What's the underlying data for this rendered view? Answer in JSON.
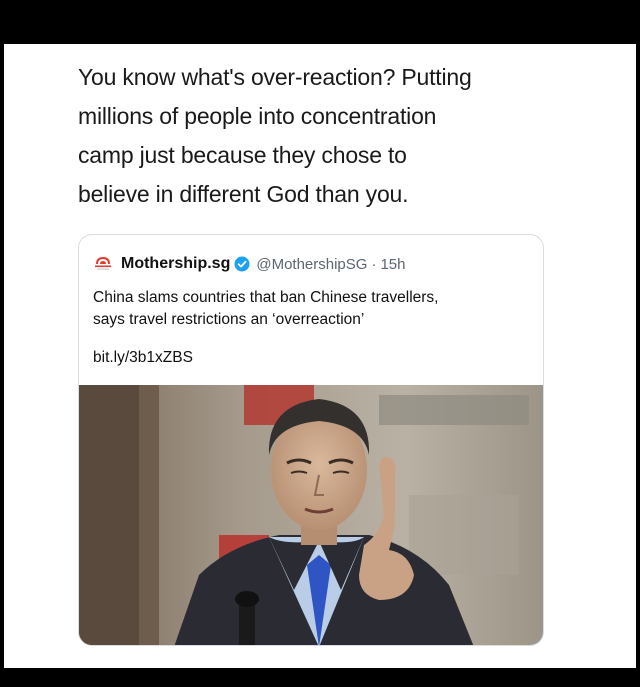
{
  "tweet": {
    "text_lines": [
      "You know what's over-reaction? Putting",
      "millions of people into concentration",
      "camp just because they chose to",
      "believe in different God than you."
    ]
  },
  "quoted_tweet": {
    "display_name": "Mothership.sg",
    "handle": "@MothershipSG",
    "separator": "·",
    "time": "15h",
    "headline_lines": [
      "China slams countries that ban Chinese travellers,",
      "says travel restrictions an ‘overreaction’"
    ],
    "link": "bit.ly/3b1xZBS",
    "logo_icon": "mothership-logo-icon",
    "verified_icon": "verified-badge-icon",
    "photo": "man-pointing-photo"
  },
  "colors": {
    "verified_blue": "#1da1f2",
    "logo_red": "#e23a2e",
    "text": "#1a1a1a",
    "secondary_text": "#5b6670",
    "card_border": "#d7dde2"
  }
}
